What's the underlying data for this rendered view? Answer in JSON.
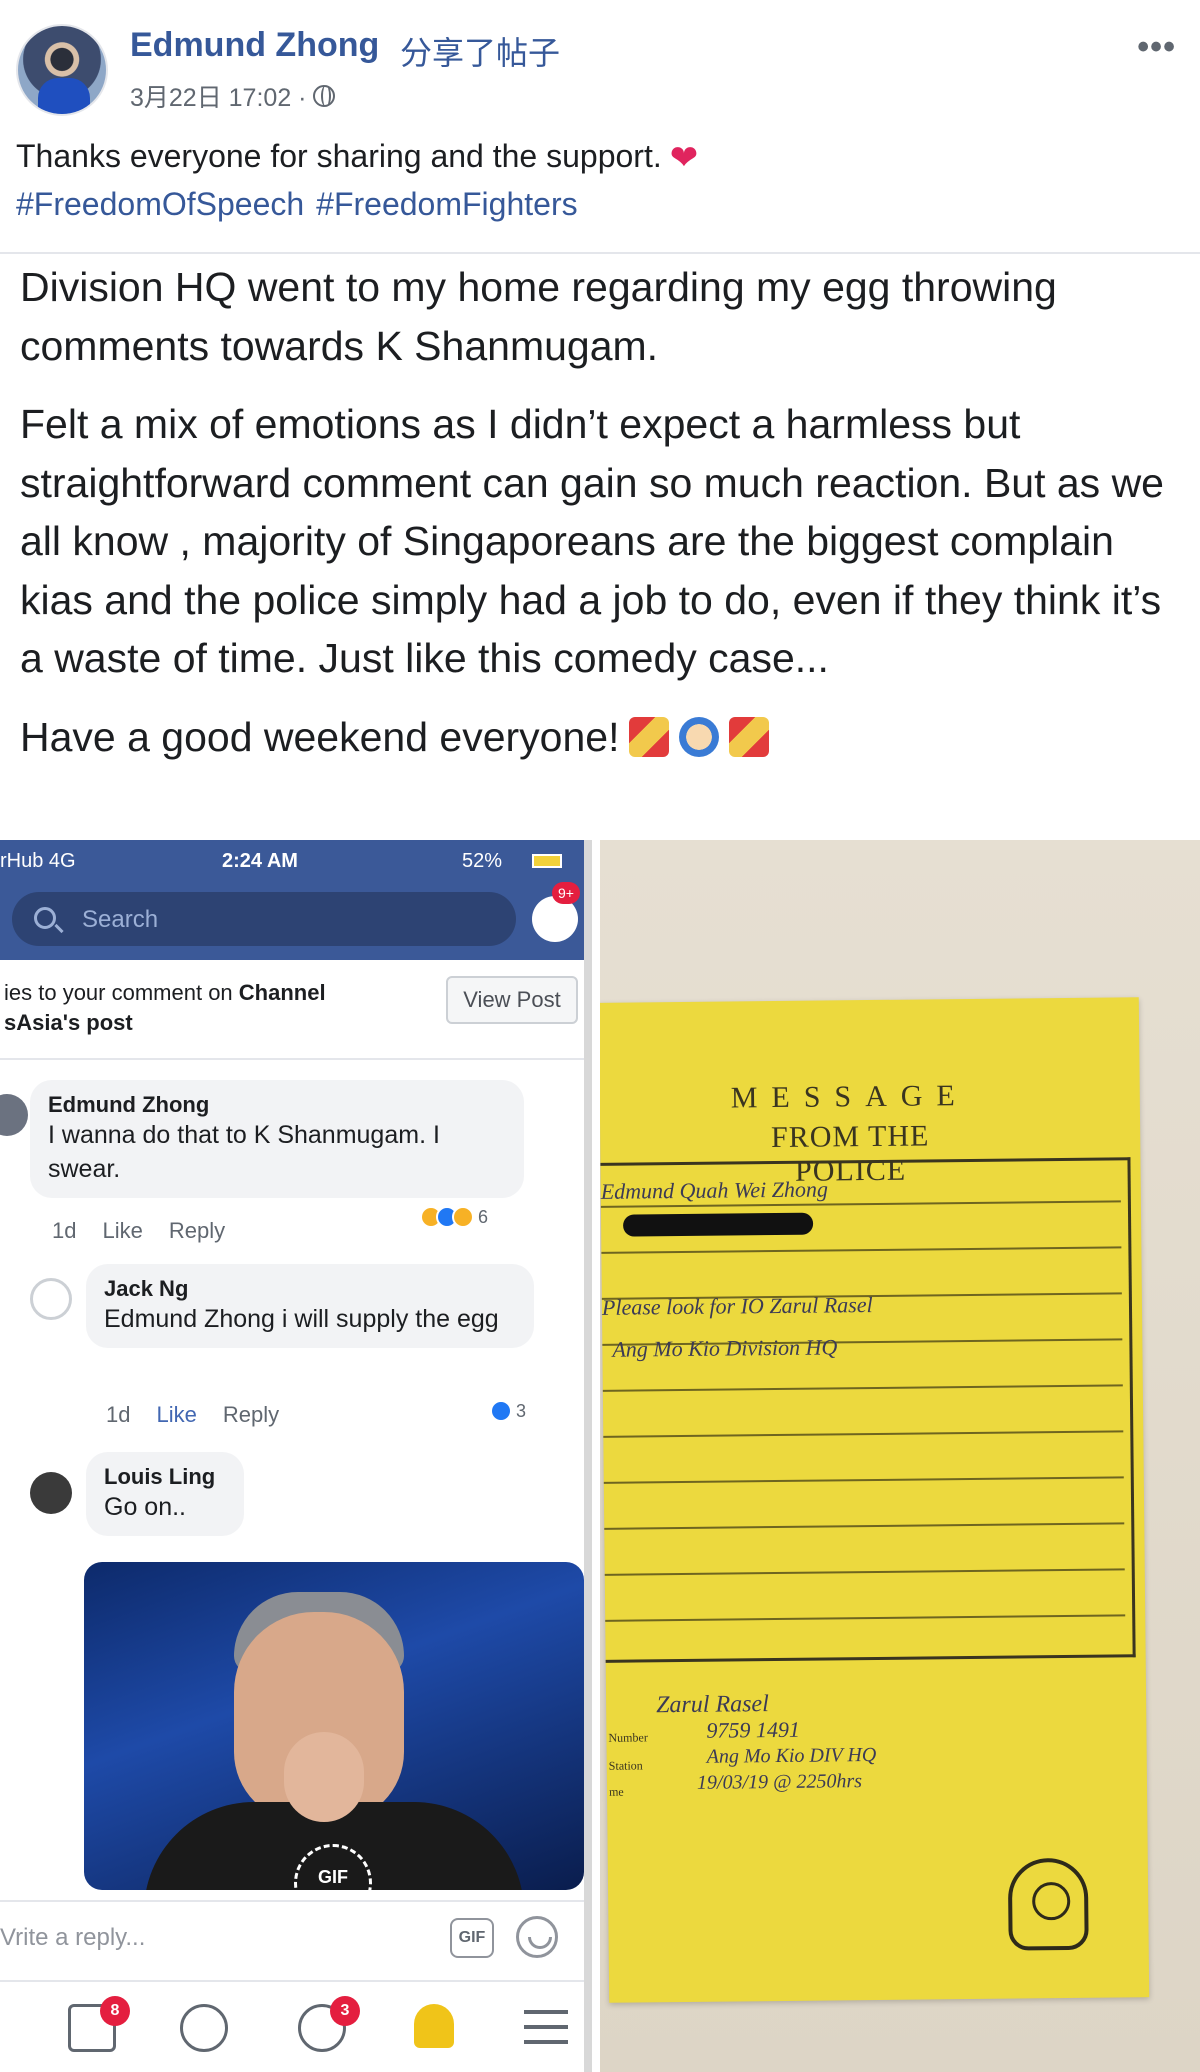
{
  "post": {
    "author": "Edmund Zhong",
    "action": "分享了帖子",
    "timestamp": "3月22日 17:02 ·",
    "caption": "Thanks everyone for sharing and the support.",
    "hashtags": [
      "#FreedomOfSpeech",
      "#FreedomFighters"
    ],
    "more": "•••"
  },
  "shared": {
    "paragraphs": [
      "Division HQ went to my home regarding my egg throwing comments towards K Shanmugam.",
      "Felt a mix of emotions as I didn’t expect a harmless but straightforward comment can gain so much reaction. But as we all know , majority of Singaporeans are the biggest complain kias and the police simply had a job to do, even if they think it’s a waste of time. Just like this comedy case...",
      "Have a good weekend everyone!"
    ]
  },
  "phone": {
    "status": {
      "carrier": "rHub  4G",
      "time": "2:24 AM",
      "battery": "52%"
    },
    "search_placeholder": "Search",
    "messenger_badge": "9+",
    "reply_notice": {
      "line1_prefix": "ies to your comment on ",
      "line1_bold": "Channel",
      "line2_bold": "sAsia's post"
    },
    "view_post": "View Post",
    "comments": [
      {
        "name": "Edmund Zhong",
        "text": "I wanna do that to K Shanmugam. I swear.",
        "age": "1d",
        "like": "Like",
        "reply": "Reply",
        "reactions": "6"
      },
      {
        "name": "Jack Ng",
        "text": "Edmund Zhong i will supply the egg",
        "age": "1d",
        "like": "Like",
        "reply": "Reply",
        "reactions": "3"
      },
      {
        "name": "Louis Ling",
        "text": "Go on..",
        "gif_label": "GIF"
      }
    ],
    "write_placeholder": "Vrite a reply...",
    "gif_button": "GIF",
    "tabs": {
      "video_badge": "8",
      "groups_badge": "3"
    }
  },
  "note": {
    "title_line1": "MESSAGE",
    "title_line2": "FROM THE POLICE",
    "handwriting": [
      "Edmund Quah Wei Zhong",
      "Please look for IO Zarul Rasel",
      "Ang Mo Kio Division HQ",
      "Zarul Rasel",
      "9759 1491",
      "Ang Mo Kio DIV HQ",
      "19/03/19 @ 2250hrs"
    ],
    "form_labels": [
      "Number",
      "Station",
      "me"
    ]
  },
  "colors": {
    "link": "#365899",
    "fb_blue": "#3b5998",
    "note_yellow": "#ecd93e"
  }
}
